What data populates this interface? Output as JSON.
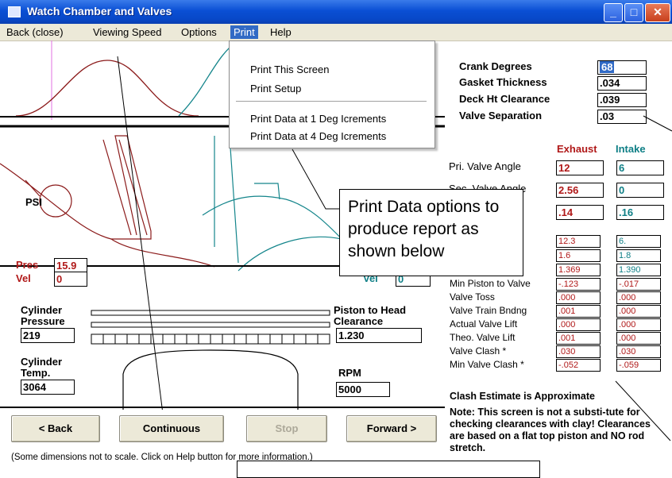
{
  "window": {
    "title": "Watch Chamber and Valves"
  },
  "menu": [
    "Back (close)",
    "Viewing Speed",
    "Options",
    "Print",
    "Help"
  ],
  "print_menu": {
    "items": [
      "Print This Screen",
      "Print Setup",
      "Print Data at 1 Deg Icrements",
      "Print Data at 4 Deg Icrements"
    ]
  },
  "top_fields": {
    "labels": [
      "Crank Degrees",
      "Gasket Thickness",
      "Deck Ht Clearance",
      "Valve Separation"
    ],
    "values": [
      "68",
      ".034",
      ".039",
      ".03"
    ]
  },
  "valves": {
    "exhaust_header": "Exhaust",
    "intake_header": "Intake",
    "pri_label": "Pri. Valve Angle",
    "pri": [
      "12",
      "6"
    ],
    "sec_label": "Sec. Valve Angle",
    "sec": [
      "2.56",
      "0"
    ],
    "third": [
      ".14",
      ".16"
    ]
  },
  "details": {
    "values_exhaust": [
      "12.3",
      "1.6",
      "1.369"
    ],
    "values_intake": [
      "6.",
      "1.8",
      "1.390"
    ],
    "rows": [
      {
        "label": "Min Piston to Valve",
        "exh": "-.123",
        "int": "-.017"
      },
      {
        "label": "Valve Toss",
        "exh": ".000",
        "int": ".000"
      },
      {
        "label": "Valve Train Bndng",
        "exh": ".001",
        "int": ".000"
      },
      {
        "label": "Actual Valve Lift",
        "exh": ".000",
        "int": ".000"
      },
      {
        "label": "Theo. Valve Lift",
        "exh": ".001",
        "int": ".000"
      },
      {
        "label": "Valve Clash *",
        "exh": ".030",
        "int": ".030"
      },
      {
        "label": "Min Valve Clash *",
        "exh": "-.052",
        "int": "-.059"
      }
    ],
    "clash_note": "Clash Estimate is Approximate",
    "note": "Note:  This screen is not a substi-tute for checking clearances with clay!  Clearances are based on a flat top piston and NO rod stretch."
  },
  "left_panel": {
    "psi": "PSI",
    "pres_label": "Pres",
    "pres_value": "15.9",
    "vel_label": "Vel",
    "vel_value": "0",
    "vel2_label": "Vel",
    "vel2_value": "0",
    "cyl_pressure_label": "Cylinder Pressure",
    "cyl_pressure_value": "219",
    "cyl_temp_label": "Cylinder Temp.",
    "cyl_temp_value": "3064",
    "piston_head_label": "Piston to Head Clearance",
    "piston_head_value": "1.230",
    "rpm_label": "RPM",
    "rpm_value": "5000"
  },
  "buttons": {
    "back": "< Back",
    "continuous": "Continuous",
    "stop": "Stop",
    "forward": "Forward >"
  },
  "footer": "(Some dimensions not to scale.  Click on Help button for more information.)",
  "callout": "Print Data options to produce report as shown below",
  "colors": {
    "title_bar": "#0a4fd4",
    "menu_highlight": "#316ac5",
    "exhaust": "#b01818",
    "intake": "#0f7f86"
  }
}
